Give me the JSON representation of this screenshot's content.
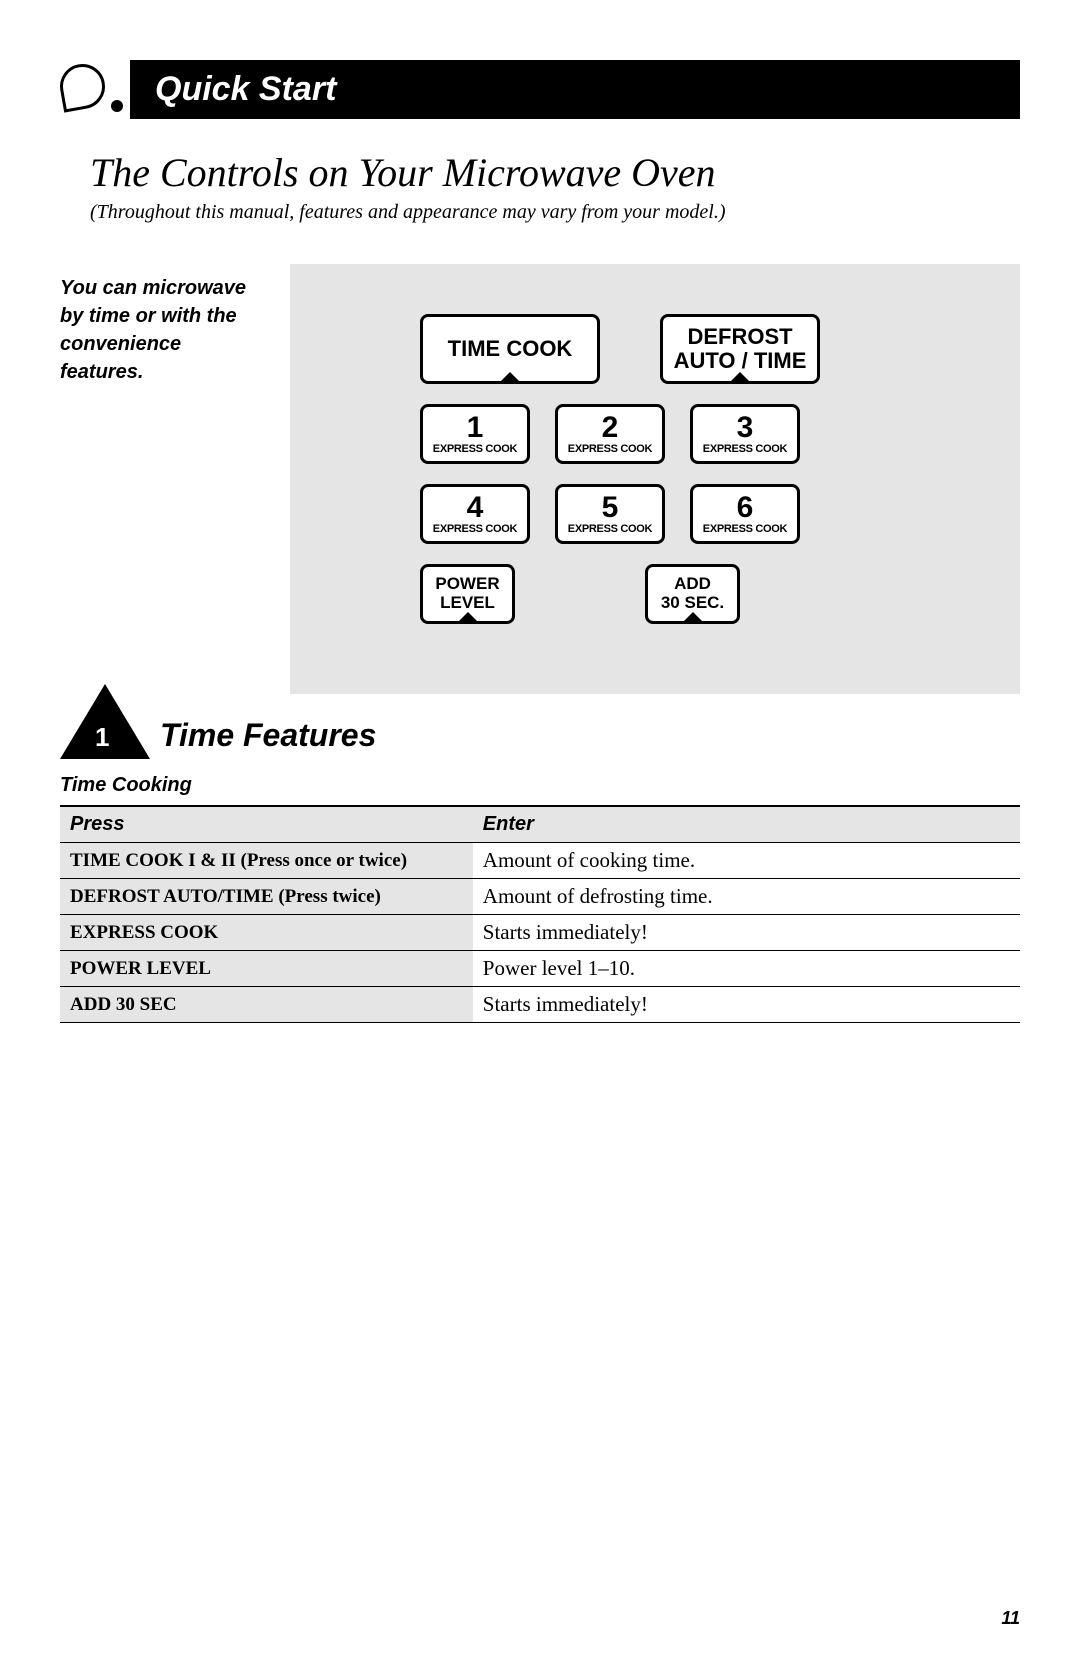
{
  "header": {
    "bar_title": "Quick Start"
  },
  "title": "The Controls on Your Microwave Oven",
  "subtitle": "(Throughout this manual, features and appearance may vary from your model.)",
  "side_note": "You can microwave by time or with the convenience features.",
  "panel": {
    "time_cook": "TIME COOK",
    "defrost_l1": "DEFROST",
    "defrost_l2": "AUTO / TIME",
    "express_label": "EXPRESS COOK",
    "nums": [
      "1",
      "2",
      "3",
      "4",
      "5",
      "6"
    ],
    "power_l1": "POWER",
    "power_l2": "LEVEL",
    "add30_l1": "ADD",
    "add30_l2": "30 SEC."
  },
  "section": {
    "num": "1",
    "title": "Time Features",
    "sub": "Time Cooking"
  },
  "table": {
    "h1": "Press",
    "h2": "Enter",
    "rows": [
      {
        "press": "TIME COOK I & II (Press once or twice)",
        "enter": "Amount of cooking time."
      },
      {
        "press": "DEFROST AUTO/TIME (Press twice)",
        "enter": "Amount of defrosting time."
      },
      {
        "press": "EXPRESS COOK",
        "enter": "Starts immediately!"
      },
      {
        "press": "POWER LEVEL",
        "enter": "Power level 1–10."
      },
      {
        "press": "ADD 30 SEC",
        "enter": "Starts immediately!"
      }
    ]
  },
  "page_num": "11"
}
